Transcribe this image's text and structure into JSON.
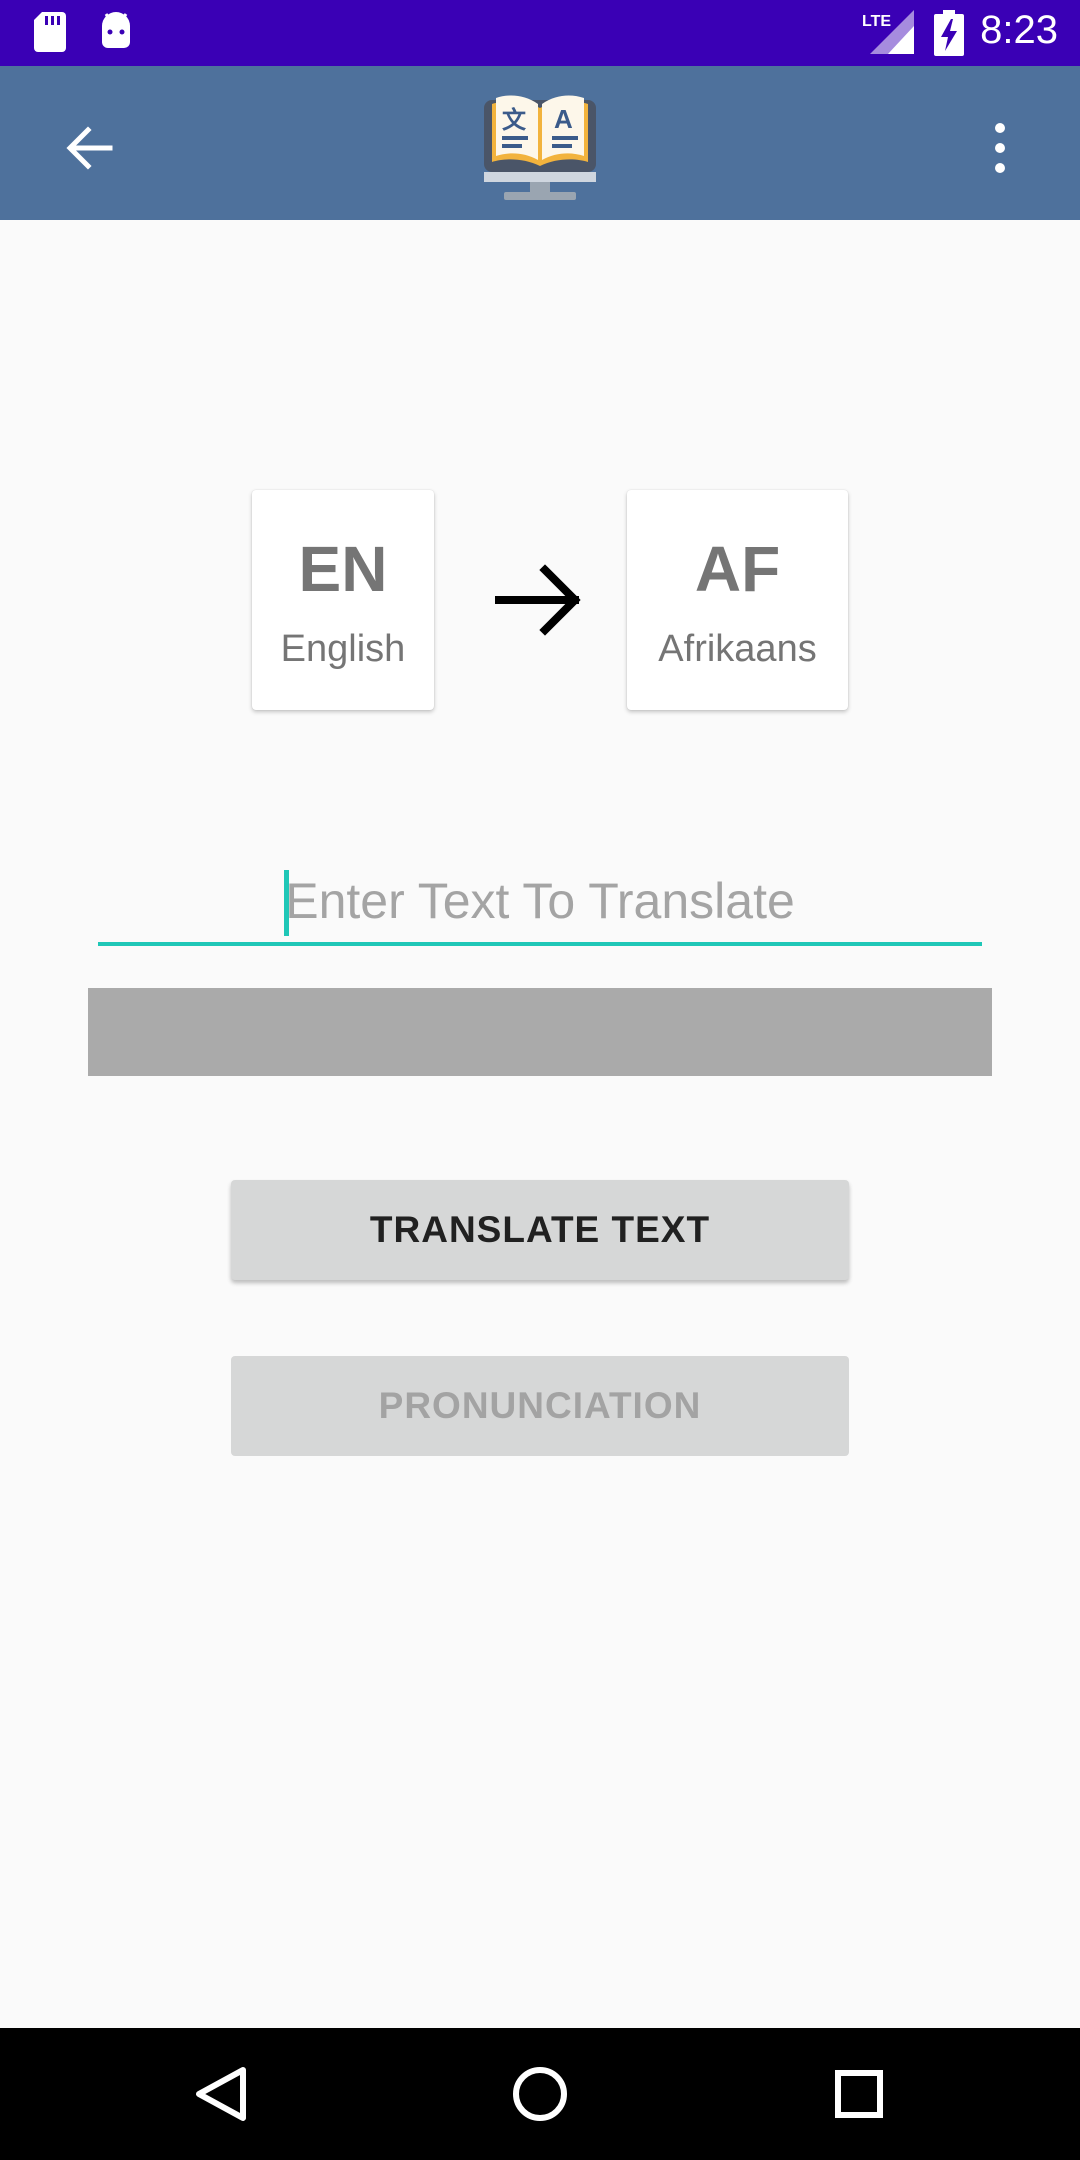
{
  "status_bar": {
    "time": "8:23",
    "network": "LTE",
    "icons": [
      "sd-card-icon",
      "android-debug-icon",
      "lte-signal-icon",
      "battery-charging-icon"
    ]
  },
  "app_bar": {
    "back_icon": "arrow-back-icon",
    "logo_icon": "translator-book-icon",
    "menu_icon": "more-vert-icon",
    "color": "#4e719c"
  },
  "languages": {
    "source": {
      "code": "EN",
      "name": "English"
    },
    "target": {
      "code": "AF",
      "name": "Afrikaans"
    },
    "arrow_icon": "arrow-forward-icon"
  },
  "input": {
    "value": "",
    "placeholder": "Enter Text To Translate",
    "accent": "#1fc7b7"
  },
  "buttons": {
    "translate": "TRANSLATE TEXT",
    "pronunciation": "PRONUNCIATION"
  },
  "nav_bar": {
    "icons": [
      "back-triangle-icon",
      "home-circle-icon",
      "recents-square-icon"
    ]
  },
  "colors": {
    "status_bar": "#3a00b5",
    "result_bar": "#aaaaaa",
    "button": "#d6d7d7"
  }
}
